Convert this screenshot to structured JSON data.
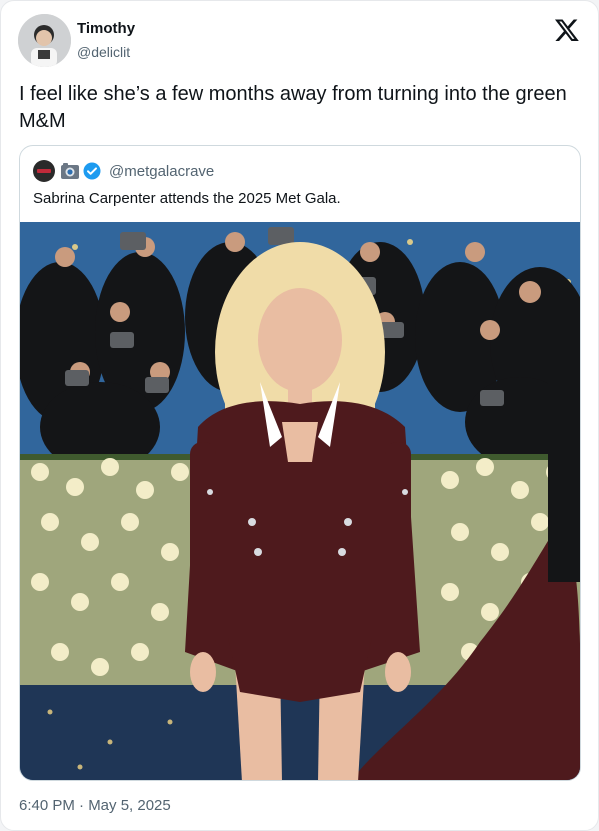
{
  "author": {
    "display_name": "Timothy",
    "handle": "@deliclit"
  },
  "tweet": {
    "text": "I feel like she’s a few months away from turning into the green M&M",
    "timestamp": "6:40 PM · May 5, 2025"
  },
  "quoted": {
    "handle": "@metgalacrave",
    "text": "Sabrina Carpenter attends the 2025 Met Gala.",
    "verified_color": "#1d9bf0"
  },
  "icons": {
    "brand": "x-logo-icon",
    "camera": "camera-icon",
    "verified": "verified-badge-icon"
  },
  "colors": {
    "background_blue": "#2c5f93",
    "flowers": "#eee6bd",
    "outfit": "#4e1a1d",
    "hair": "#f0dca8",
    "carpet": "#1f3656"
  }
}
